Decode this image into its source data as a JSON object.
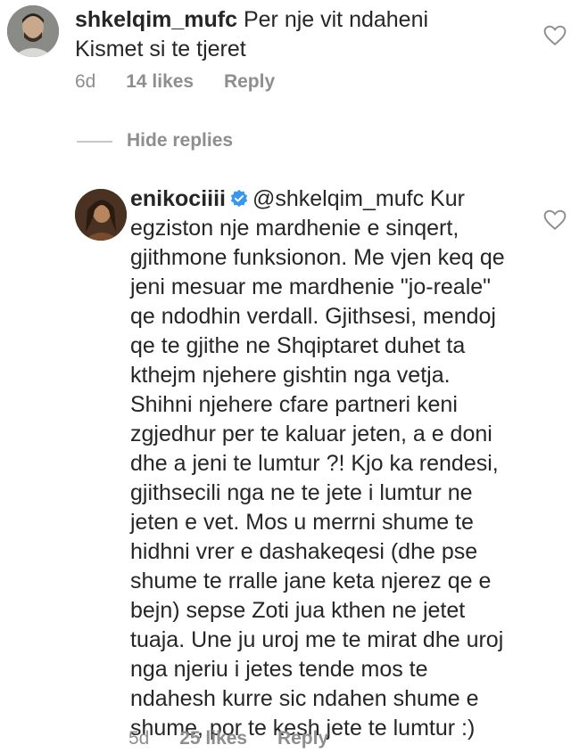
{
  "comments": [
    {
      "username": "shkelqim_mufc",
      "text": "Per nje vit ndaheni\nKismet si te tjeret",
      "time": "6d",
      "likes": "14 likes",
      "reply_label": "Reply"
    },
    {
      "username": "enikociiii",
      "verified": true,
      "mention": "@shkelqim_mufc",
      "text": "Kur egziston nje mardhenie e sinqert, gjithmone funksionon. Me vjen keq qe jeni mesuar me mardhenie \"jo-reale\" qe ndodhin verdall. Gjithsesi, mendoj qe te gjithe ne Shqiptaret duhet ta kthejm njehere gishtin nga vetja. Shihni njehere cfare partneri keni zgjedhur per te kaluar jeten, a e doni dhe a jeni te lumtur ?! Kjo ka rendesi, gjithsecili nga ne te jete i lumtur ne jeten e vet. Mos u merrni shume te hidhni vrer e dashakeqesi (dhe pse shume te rralle jane keta njerez qe e bejn) sepse Zoti jua kthen ne jetet tuaja. Une ju uroj me te mirat dhe uroj nga njeriu i jetes tende mos te ndahesh kurre sic ndahen shume e shume, por te kesh jete te lumtur :)",
      "time": "5d",
      "likes": "25 likes",
      "reply_label": "Reply"
    }
  ],
  "hide_replies_label": "Hide replies",
  "colors": {
    "text": "#262626",
    "meta": "#8e8e8e",
    "verified": "#3897f0"
  }
}
